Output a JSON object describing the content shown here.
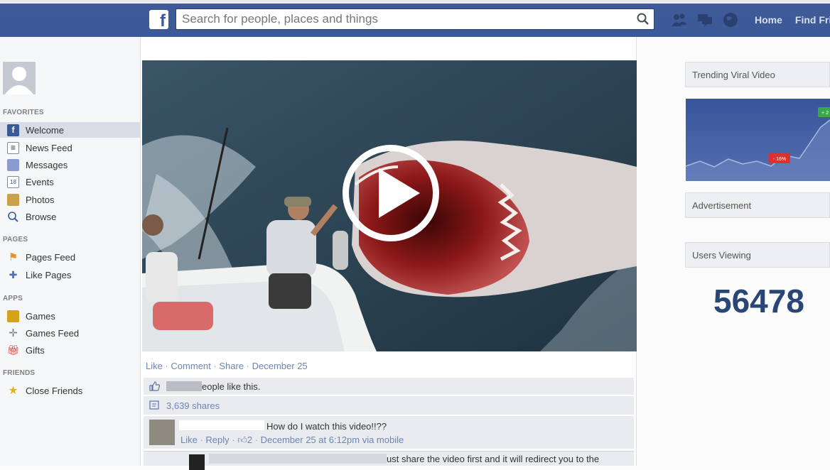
{
  "header": {
    "search_placeholder": "Search for people, places and things",
    "nav_links": [
      "Home",
      "Find Fri"
    ]
  },
  "sidebar": {
    "sections": [
      {
        "title": "FAVORITES",
        "items": [
          "Welcome",
          "News Feed",
          "Messages",
          "Events",
          "Photos",
          "Browse"
        ]
      },
      {
        "title": "PAGES",
        "items": [
          "Pages Feed",
          "Like Pages"
        ]
      },
      {
        "title": "APPS",
        "items": [
          "Games",
          "Games Feed",
          "Gifts"
        ]
      },
      {
        "title": "FRIENDS",
        "items": [
          "Close Friends"
        ]
      }
    ]
  },
  "post": {
    "actions": {
      "like": "Like",
      "comment": "Comment",
      "share": "Share",
      "date": "December 25",
      "sep": " · "
    },
    "likes_text": "eople like this.",
    "shares_text": "3,639 shares",
    "comments": [
      {
        "text": "How do I watch this video!!??",
        "like": "Like",
        "reply": "Reply",
        "likes_count": "2",
        "meta": "December 25 at 6:12pm via mobile"
      },
      {
        "text": "ust share the video first and it will redirect you to the"
      }
    ]
  },
  "right_column": {
    "trending_title": "Trending Viral Video",
    "chart_badges": [
      "- 16%",
      "+ 2"
    ],
    "ad_title": "Advertisement",
    "users_title": "Users Viewing",
    "users_count": "56478"
  },
  "colors": {
    "brand": "#3b5998",
    "link": "#6d84b4"
  }
}
